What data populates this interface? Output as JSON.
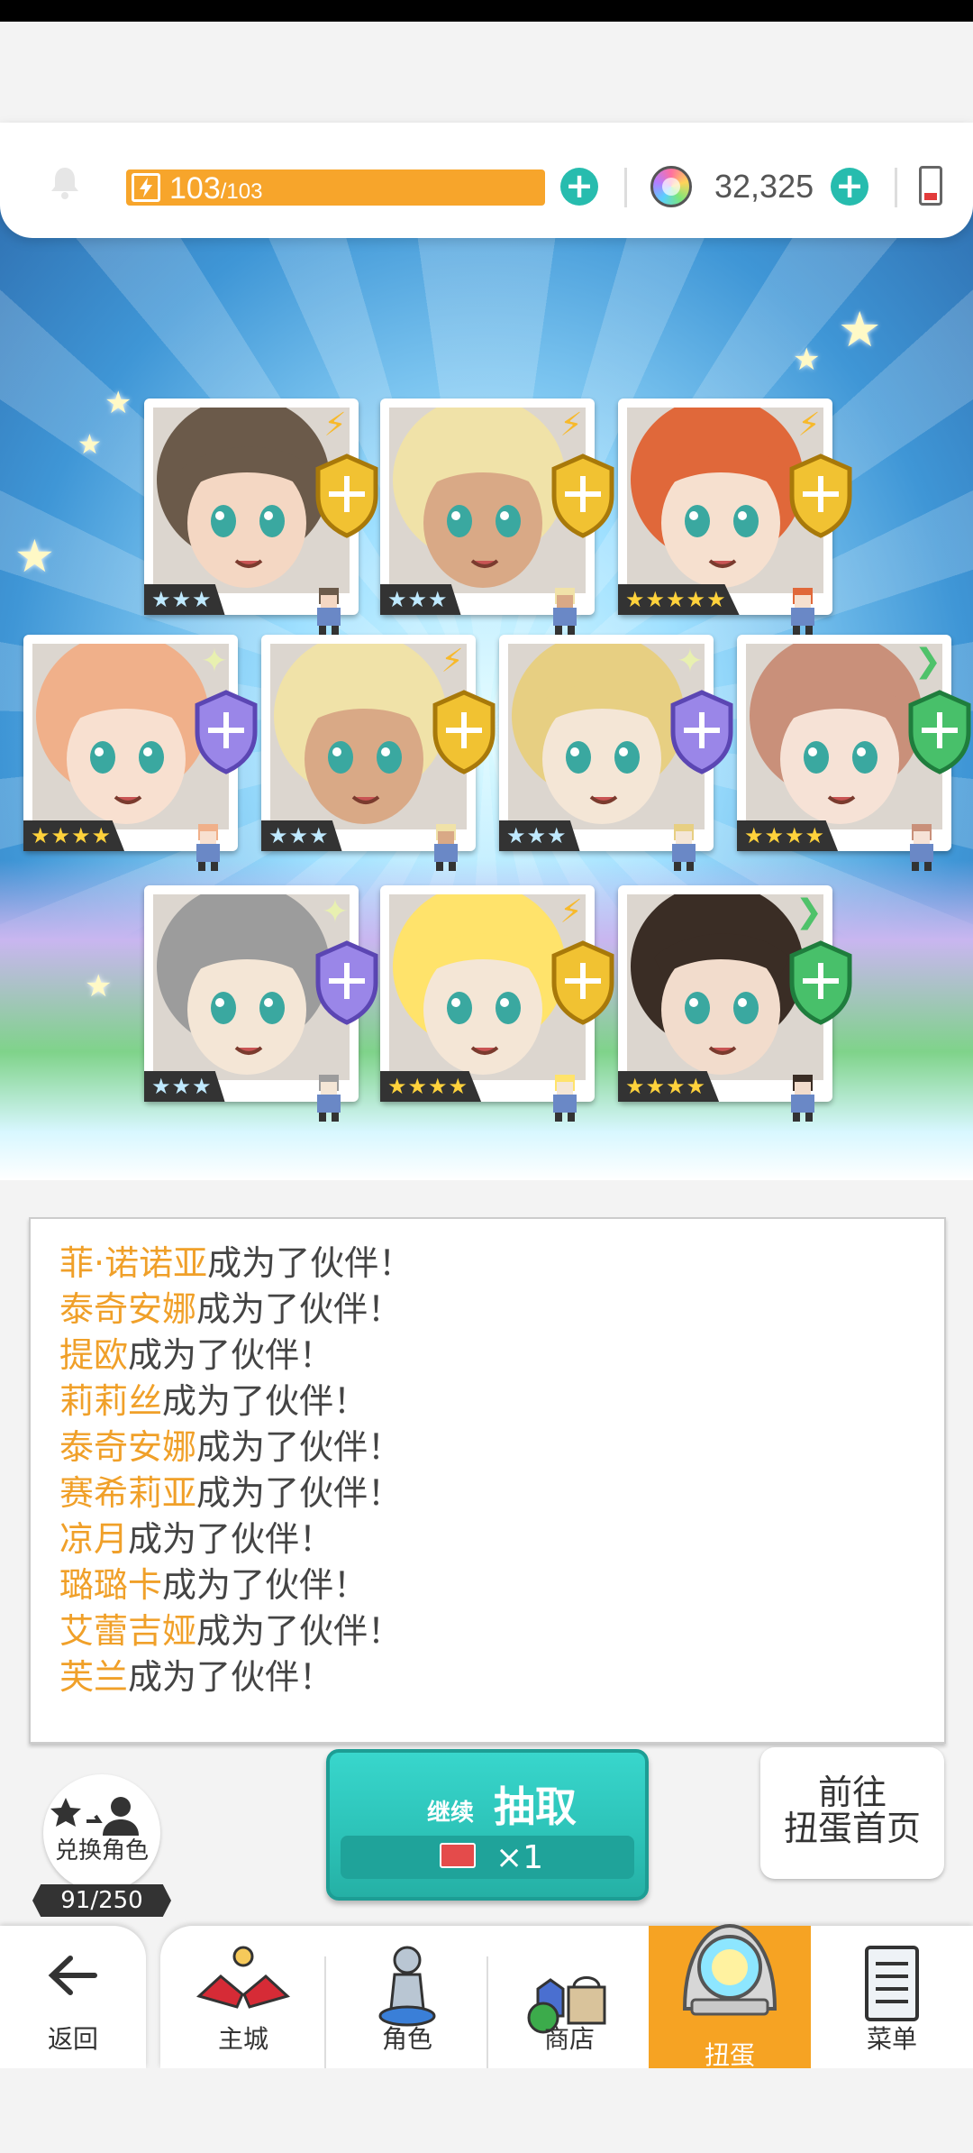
{
  "topbar": {
    "stamina_current": "103",
    "stamina_sep": "/",
    "stamina_max": "103",
    "gems": "32,325"
  },
  "cards": [
    {
      "stars": "★★★",
      "rarity": 3,
      "element": "lightning",
      "cls": "gold-sword"
    },
    {
      "stars": "★★★",
      "rarity": 3,
      "element": "lightning",
      "cls": "gold-sword"
    },
    {
      "stars": "★★★★★",
      "rarity": 5,
      "element": "lightning",
      "cls": "gold-sword"
    },
    {
      "stars": "★★★★",
      "rarity": 4,
      "element": "light",
      "cls": "purple-shield"
    },
    {
      "stars": "★★★",
      "rarity": 3,
      "element": "lightning",
      "cls": "gold-sword"
    },
    {
      "stars": "★★★",
      "rarity": 3,
      "element": "light",
      "cls": "purple-shield"
    },
    {
      "stars": "★★★★",
      "rarity": 4,
      "element": "wind",
      "cls": "green-heal"
    },
    {
      "stars": "★★★",
      "rarity": 3,
      "element": "light",
      "cls": "purple-shield"
    },
    {
      "stars": "★★★★",
      "rarity": 4,
      "element": "lightning",
      "cls": "gold-sword"
    },
    {
      "stars": "★★★★",
      "rarity": 4,
      "element": "wind",
      "cls": "green-heal"
    }
  ],
  "messages": [
    {
      "name": "菲·诺诺亚",
      "text": "成为了伙伴！"
    },
    {
      "name": "泰奇安娜",
      "text": "成为了伙伴！"
    },
    {
      "name": "提欧",
      "text": "成为了伙伴！"
    },
    {
      "name": "莉莉丝",
      "text": "成为了伙伴！"
    },
    {
      "name": "泰奇安娜",
      "text": "成为了伙伴！"
    },
    {
      "name": "赛希莉亚",
      "text": "成为了伙伴！"
    },
    {
      "name": "凉月",
      "text": "成为了伙伴！"
    },
    {
      "name": "璐璐卡",
      "text": "成为了伙伴！"
    },
    {
      "name": "艾蕾吉娅",
      "text": "成为了伙伴！"
    },
    {
      "name": "芙兰",
      "text": "成为了伙伴！"
    }
  ],
  "exchange": {
    "label": "兑换角色",
    "count": "91/250"
  },
  "pull": {
    "continue_label": "继续",
    "main_label": "抽取",
    "qty": "×1"
  },
  "go_home": {
    "line1": "前往",
    "line2": "扭蛋首页"
  },
  "nav": {
    "back": "返回",
    "tabs": [
      {
        "label": "主城",
        "icon": "castle-icon"
      },
      {
        "label": "角色",
        "icon": "character-icon"
      },
      {
        "label": "商店",
        "icon": "shop-icon"
      },
      {
        "label": "扭蛋",
        "icon": "gacha-icon",
        "active": true
      },
      {
        "label": "菜单",
        "icon": "menu-icon"
      }
    ]
  },
  "colors": {
    "accent_orange": "#f6a323",
    "teal": "#2cc2b7",
    "name_orange": "#f0a029"
  }
}
